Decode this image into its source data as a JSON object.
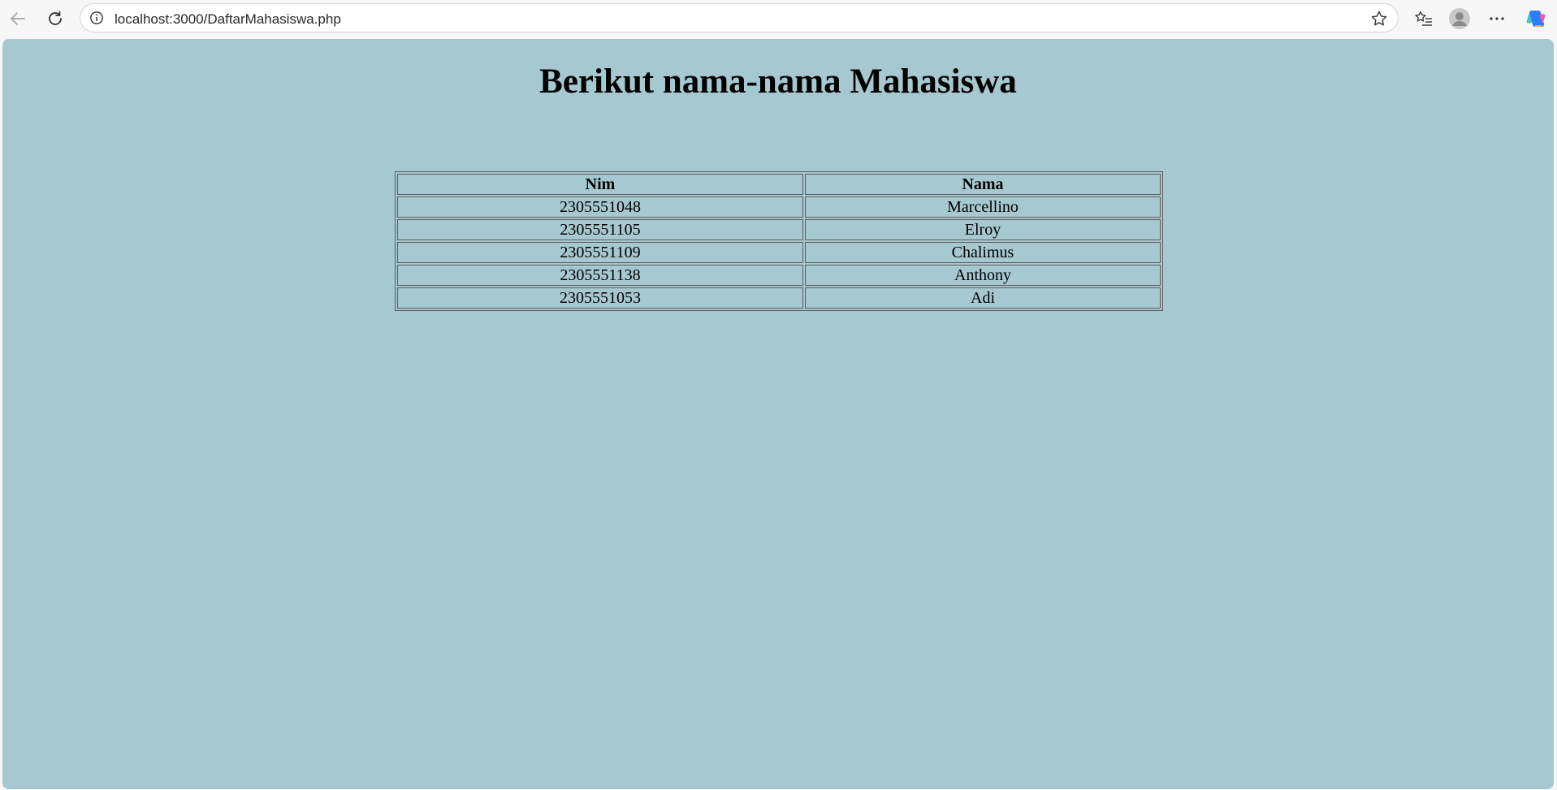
{
  "browser": {
    "url": "localhost:3000/DaftarMahasiswa.php"
  },
  "page": {
    "title": "Berikut nama-nama Mahasiswa",
    "background": "#a6c9d1"
  },
  "table": {
    "headers": {
      "nim": "Nim",
      "nama": "Nama"
    },
    "rows": [
      {
        "nim": "2305551048",
        "nama": "Marcellino"
      },
      {
        "nim": "2305551105",
        "nama": "Elroy"
      },
      {
        "nim": "2305551109",
        "nama": "Chalimus"
      },
      {
        "nim": "2305551138",
        "nama": "Anthony"
      },
      {
        "nim": "2305551053",
        "nama": "Adi"
      }
    ]
  }
}
